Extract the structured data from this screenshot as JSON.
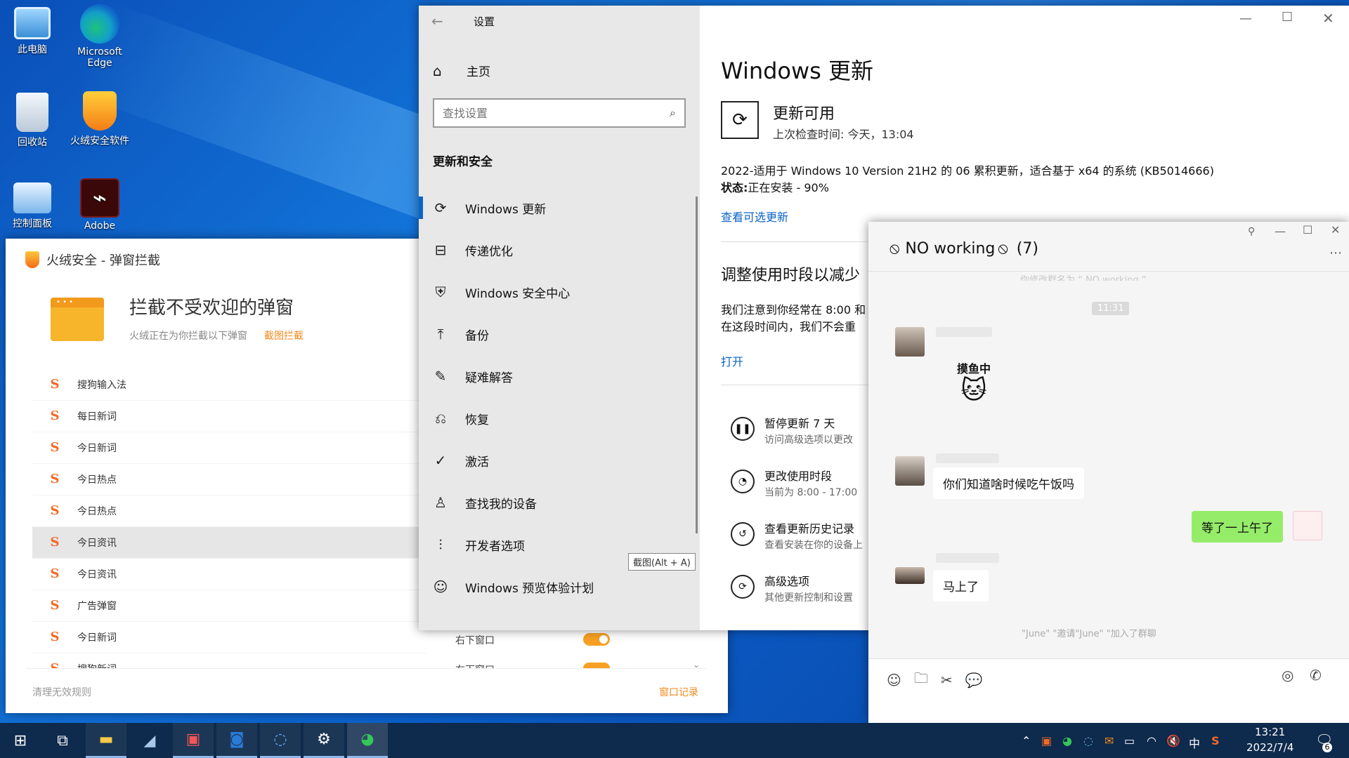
{
  "desktop": {
    "icons": [
      {
        "label": "此电脑"
      },
      {
        "label": "Microsoft Edge"
      },
      {
        "label": "回收站"
      },
      {
        "label": "火绒安全软件"
      },
      {
        "label": "控制面板"
      },
      {
        "label": "Adobe"
      }
    ]
  },
  "huorong": {
    "title": "火绒安全 - 弹窗拦截",
    "heading": "拦截不受欢迎的弹窗",
    "subtitle": "火绒正在为你拦截以下弹窗",
    "subtitle_link": "截图拦截",
    "rows": [
      "搜狗输入法",
      "每日新词",
      "今日新词",
      "今日热点",
      "今日热点",
      "今日资讯",
      "今日资讯",
      "广告弹窗",
      "今日新词",
      "搜狗新词"
    ],
    "row_right_labels": [
      "右下窗口",
      "右下窗口"
    ],
    "footer_left": "清理无效规则",
    "footer_right": "窗口记录"
  },
  "settings": {
    "title": "设置",
    "home": "主页",
    "search_placeholder": "查找设置",
    "section": "更新和安全",
    "nav": [
      {
        "label": "Windows 更新",
        "icon": "sync-icon"
      },
      {
        "label": "传递优化",
        "icon": "delivery-icon"
      },
      {
        "label": "Windows 安全中心",
        "icon": "shield-icon"
      },
      {
        "label": "备份",
        "icon": "backup-icon"
      },
      {
        "label": "疑难解答",
        "icon": "wrench-icon"
      },
      {
        "label": "恢复",
        "icon": "recovery-icon"
      },
      {
        "label": "激活",
        "icon": "check-circle-icon"
      },
      {
        "label": "查找我的设备",
        "icon": "person-pin-icon"
      },
      {
        "label": "开发者选项",
        "icon": "developer-icon"
      },
      {
        "label": "Windows 预览体验计划",
        "icon": "insider-icon"
      }
    ],
    "tooltip": "截图(Alt + A)",
    "page_title": "Windows 更新",
    "status_title": "更新可用",
    "last_checked": "上次检查时间: 今天，13:04",
    "update_name": "2022-适用于 Windows 10 Version 21H2 的 06 累积更新，适合基于 x64 的系统 (KB5014666)",
    "status_label": "状态:",
    "status_value": "正在安装 - 90%",
    "install_progress": 0.9,
    "optional_link": "查看可选更新",
    "section2": "调整使用时段以减少",
    "section2_body1": "我们注意到你经常在 8:00 和",
    "section2_body2": "在这段时间内，我们不会重",
    "open_link": "打开",
    "options": [
      {
        "t1": "暂停更新 7 天",
        "t2": "访问高级选项以更改",
        "icon": "pause-icon"
      },
      {
        "t1": "更改使用时段",
        "t2": "当前为 8:00 - 17:00",
        "icon": "clock-icon"
      },
      {
        "t1": "查看更新历史记录",
        "t2": "查看安装在你的设备上",
        "icon": "history-icon"
      },
      {
        "t1": "高级选项",
        "t2": "其他更新控制和设置",
        "icon": "advanced-sync-icon"
      }
    ]
  },
  "chat": {
    "title": "NO working",
    "count": "(7)",
    "faded_top": "你修改群名为 “ NO working ”",
    "time": "11:31",
    "sticker_text": "摸鱼中",
    "msg1": "你们知道啥时候吃午饭吗",
    "msg_me": "等了一上午了",
    "msg3": "马上了",
    "system_note": "\"June\" \"邀请\"June\" \"加入了群聊"
  },
  "taskbar": {
    "time": "13:21",
    "date": "2022/7/4",
    "notif_count": "6",
    "ime": "中"
  }
}
